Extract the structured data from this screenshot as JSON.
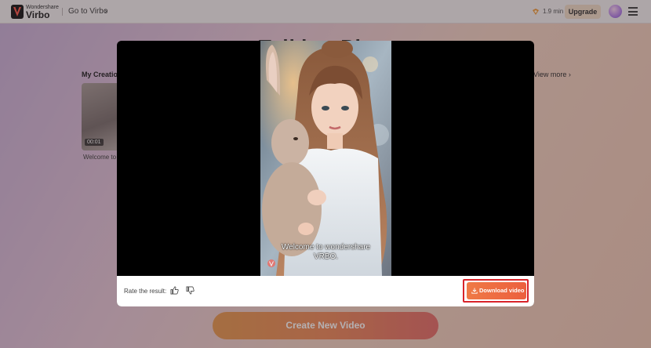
{
  "header": {
    "brand_top": "Wondershare",
    "brand_main": "Virbo",
    "goto_label": "Go to Virbo",
    "credits": "1.9 min",
    "upgrade_label": "Upgrade"
  },
  "page": {
    "title": "Talking Photo",
    "my_creations_label": "My Creations",
    "view_more_label": "View more",
    "creation_item": {
      "duration": "00:01",
      "caption": "Welcome to"
    },
    "create_button_label": "Create New Video"
  },
  "modal": {
    "subtitle_line1": "Welcome to wondershare",
    "subtitle_line2": "VRBO.",
    "watermark": "Virbo",
    "rate_label": "Rate the result:",
    "download_label": "Download video"
  },
  "colors": {
    "accent_orange": "#ec6a40",
    "highlight_red": "#d8232a",
    "create_gradient_start": "#e89a52",
    "create_gradient_end": "#e6706b"
  }
}
